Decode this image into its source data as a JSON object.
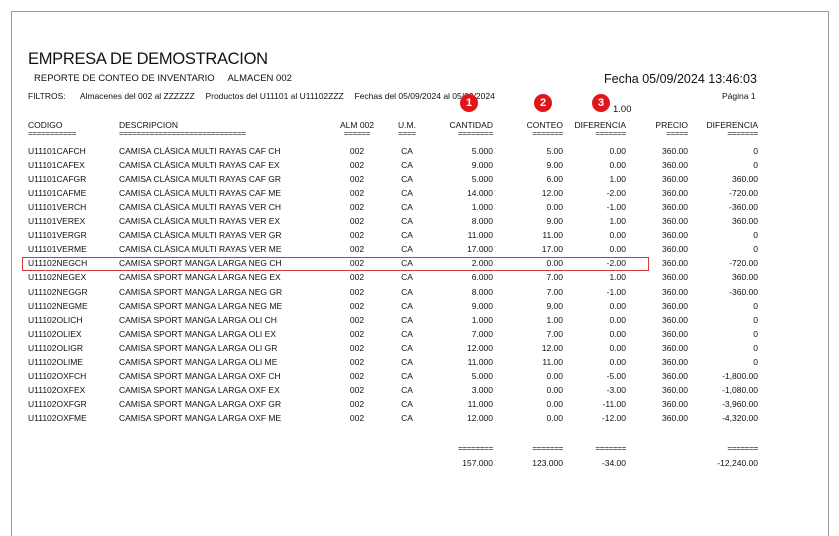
{
  "report": {
    "company": "EMPRESA DE DEMOSTRACION",
    "subtitle_report": "REPORTE DE CONTEO DE INVENTARIO",
    "subtitle_almacen": "ALMACEN 002",
    "fecha": "Fecha 05/09/2024 13:46:03",
    "filtros_label": "FILTROS:",
    "filtros_almacenes": "Almacenes del 002 al ZZZZZZ",
    "filtros_productos": "Productos del U11101 al U11102ZZZ",
    "filtros_fechas": "Fechas del 05/09/2024 al 05/09/2024",
    "pagina": "Página 1",
    "extra_value": "1.00"
  },
  "badges": [
    "1",
    "2",
    "3"
  ],
  "badge_color": "#e0151c",
  "highlight_color": "#d23b3b",
  "columns": {
    "codigo": "CODIGO",
    "descripcion": "DESCRIPCION",
    "alm": "ALM 002",
    "um": "U.M.",
    "cantidad": "CANTIDAD",
    "conteo": "CONTEO",
    "diferencia": "DIFERENCIA",
    "precio": "PRECIO",
    "diferencia2": "DIFERENCIA"
  },
  "separators": {
    "codigo": "===========",
    "descripcion": "=============================",
    "alm": "======",
    "um": "====",
    "cantidad": "========",
    "conteo": "=======",
    "diferencia": "=======",
    "precio": "=====",
    "diferencia2": "======="
  },
  "rows": [
    {
      "codigo": "U11101CAFCH",
      "descripcion": "CAMISA CLÁSICA MULTI RAYAS CAF CH",
      "alm": "002",
      "um": "CA",
      "cantidad": "5.000",
      "conteo": "5.00",
      "diferencia": "0.00",
      "precio": "360.00",
      "diferencia2": "0"
    },
    {
      "codigo": "U11101CAFEX",
      "descripcion": "CAMISA CLÁSICA MULTI RAYAS CAF EX",
      "alm": "002",
      "um": "CA",
      "cantidad": "9.000",
      "conteo": "9.00",
      "diferencia": "0.00",
      "precio": "360.00",
      "diferencia2": "0"
    },
    {
      "codigo": "U11101CAFGR",
      "descripcion": "CAMISA CLÁSICA MULTI RAYAS CAF GR",
      "alm": "002",
      "um": "CA",
      "cantidad": "5.000",
      "conteo": "6.00",
      "diferencia": "1.00",
      "precio": "360.00",
      "diferencia2": "360.00"
    },
    {
      "codigo": "U11101CAFME",
      "descripcion": "CAMISA CLÁSICA MULTI RAYAS CAF ME",
      "alm": "002",
      "um": "CA",
      "cantidad": "14.000",
      "conteo": "12.00",
      "diferencia": "-2.00",
      "precio": "360.00",
      "diferencia2": "-720.00"
    },
    {
      "codigo": "U11101VERCH",
      "descripcion": "CAMISA CLÁSICA MULTI RAYAS VER CH",
      "alm": "002",
      "um": "CA",
      "cantidad": "1.000",
      "conteo": "0.00",
      "diferencia": "-1.00",
      "precio": "360.00",
      "diferencia2": "-360.00"
    },
    {
      "codigo": "U11101VEREX",
      "descripcion": "CAMISA CLÁSICA MULTI RAYAS VER EX",
      "alm": "002",
      "um": "CA",
      "cantidad": "8.000",
      "conteo": "9.00",
      "diferencia": "1.00",
      "precio": "360.00",
      "diferencia2": "360.00"
    },
    {
      "codigo": "U11101VERGR",
      "descripcion": "CAMISA CLÁSICA MULTI RAYAS VER GR",
      "alm": "002",
      "um": "CA",
      "cantidad": "11.000",
      "conteo": "11.00",
      "diferencia": "0.00",
      "precio": "360.00",
      "diferencia2": "0"
    },
    {
      "codigo": "U11101VERME",
      "descripcion": "CAMISA CLÁSICA MULTI RAYAS VER ME",
      "alm": "002",
      "um": "CA",
      "cantidad": "17.000",
      "conteo": "17.00",
      "diferencia": "0.00",
      "precio": "360.00",
      "diferencia2": "0"
    },
    {
      "codigo": "U11102NEGCH",
      "descripcion": "CAMISA SPORT MANGA LARGA NEG CH",
      "alm": "002",
      "um": "CA",
      "cantidad": "2.000",
      "conteo": "0.00",
      "diferencia": "-2.00",
      "precio": "360.00",
      "diferencia2": "-720.00"
    },
    {
      "codigo": "U11102NEGEX",
      "descripcion": "CAMISA SPORT MANGA LARGA NEG EX",
      "alm": "002",
      "um": "CA",
      "cantidad": "6.000",
      "conteo": "7.00",
      "diferencia": "1.00",
      "precio": "360.00",
      "diferencia2": "360.00"
    },
    {
      "codigo": "U11102NEGGR",
      "descripcion": "CAMISA SPORT MANGA LARGA NEG GR",
      "alm": "002",
      "um": "CA",
      "cantidad": "8.000",
      "conteo": "7.00",
      "diferencia": "-1.00",
      "precio": "360.00",
      "diferencia2": "-360.00"
    },
    {
      "codigo": "U11102NEGME",
      "descripcion": "CAMISA SPORT MANGA LARGA NEG ME",
      "alm": "002",
      "um": "CA",
      "cantidad": "9.000",
      "conteo": "9.00",
      "diferencia": "0.00",
      "precio": "360.00",
      "diferencia2": "0"
    },
    {
      "codigo": "U11102OLICH",
      "descripcion": "CAMISA SPORT MANGA LARGA OLI CH",
      "alm": "002",
      "um": "CA",
      "cantidad": "1.000",
      "conteo": "1.00",
      "diferencia": "0.00",
      "precio": "360.00",
      "diferencia2": "0"
    },
    {
      "codigo": "U11102OLIEX",
      "descripcion": "CAMISA SPORT MANGA LARGA OLI EX",
      "alm": "002",
      "um": "CA",
      "cantidad": "7.000",
      "conteo": "7.00",
      "diferencia": "0.00",
      "precio": "360.00",
      "diferencia2": "0"
    },
    {
      "codigo": "U11102OLIGR",
      "descripcion": "CAMISA SPORT MANGA LARGA OLI GR",
      "alm": "002",
      "um": "CA",
      "cantidad": "12.000",
      "conteo": "12.00",
      "diferencia": "0.00",
      "precio": "360.00",
      "diferencia2": "0"
    },
    {
      "codigo": "U11102OLIME",
      "descripcion": "CAMISA SPORT MANGA LARGA OLI ME",
      "alm": "002",
      "um": "CA",
      "cantidad": "11.000",
      "conteo": "11.00",
      "diferencia": "0.00",
      "precio": "360.00",
      "diferencia2": "0"
    },
    {
      "codigo": "U11102OXFCH",
      "descripcion": "CAMISA SPORT MANGA LARGA OXF CH",
      "alm": "002",
      "um": "CA",
      "cantidad": "5.000",
      "conteo": "0.00",
      "diferencia": "-5.00",
      "precio": "360.00",
      "diferencia2": "-1,800.00"
    },
    {
      "codigo": "U11102OXFEX",
      "descripcion": "CAMISA SPORT MANGA LARGA OXF EX",
      "alm": "002",
      "um": "CA",
      "cantidad": "3.000",
      "conteo": "0.00",
      "diferencia": "-3.00",
      "precio": "360.00",
      "diferencia2": "-1,080.00"
    },
    {
      "codigo": "U11102OXFGR",
      "descripcion": "CAMISA SPORT MANGA LARGA OXF GR",
      "alm": "002",
      "um": "CA",
      "cantidad": "11.000",
      "conteo": "0.00",
      "diferencia": "-11.00",
      "precio": "360.00",
      "diferencia2": "-3,960.00"
    },
    {
      "codigo": "U11102OXFME",
      "descripcion": "CAMISA SPORT MANGA LARGA OXF ME",
      "alm": "002",
      "um": "CA",
      "cantidad": "12.000",
      "conteo": "0.00",
      "diferencia": "-12.00",
      "precio": "360.00",
      "diferencia2": "-4,320.00"
    }
  ],
  "totals": {
    "sep_cantidad": "========",
    "sep_conteo": "=======",
    "sep_diferencia": "=======",
    "sep_diferencia2": "=======",
    "cantidad": "157.000",
    "conteo": "123.000",
    "diferencia": "-34.00",
    "diferencia2": "-12,240.00"
  }
}
